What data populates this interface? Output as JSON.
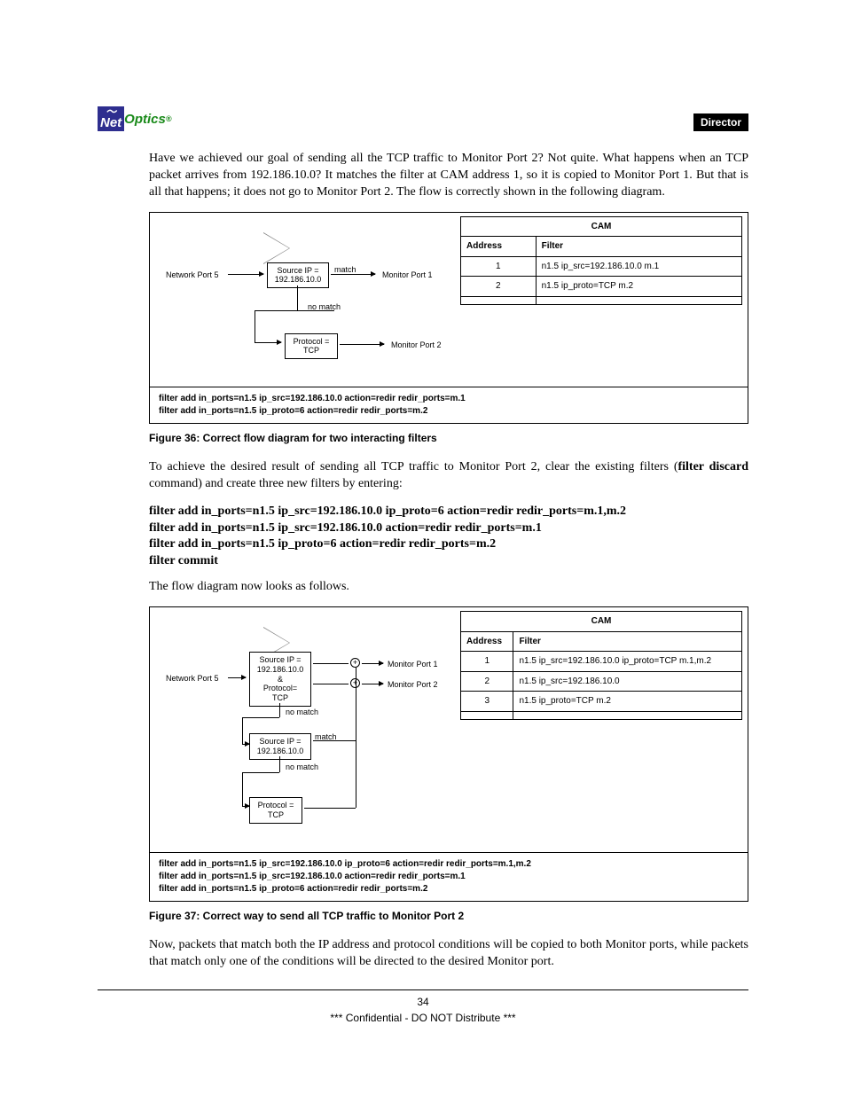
{
  "header": {
    "logo_net": "Net",
    "logo_optics": "Optics",
    "logo_reg": "®",
    "doc_tag": "Director"
  },
  "para1": "Have we achieved our goal of sending all the TCP traffic to Monitor Port 2? Not quite. What happens when an TCP packet arrives from 192.186.10.0? It matches the filter at CAM address 1, so it is copied to Monitor Port 1. But that is all that happens; it does not go to Monitor Port 2. The flow is correctly shown in the following diagram.",
  "fig36": {
    "network_port": "Network Port 5",
    "src_ip": "Source IP =\n192.186.10.0",
    "match": "match",
    "no_match": "no match",
    "proto": "Protocol =\nTCP",
    "mon1": "Monitor Port 1",
    "mon2": "Monitor Port 2",
    "cmds": [
      "filter add in_ports=n1.5 ip_src=192.186.10.0 action=redir redir_ports=m.1",
      "filter add in_ports=n1.5 ip_proto=6 action=redir redir_ports=m.2"
    ],
    "cam_title": "CAM",
    "h_addr": "Address",
    "h_filter": "Filter",
    "rows": [
      {
        "a": "1",
        "f": "n1.5 ip_src=192.186.10.0 m.1"
      },
      {
        "a": "2",
        "f": "n1.5 ip_proto=TCP m.2"
      },
      {
        "a": "",
        "f": ""
      }
    ],
    "caption": "Figure 36: Correct flow diagram for two interacting filters"
  },
  "para2a": "To achieve the desired result of sending all TCP traffic to Monitor Port 2, clear the existing filters (",
  "para2b": "filter discard",
  "para2c": " command) and create three new filters by entering:",
  "cmdblock": [
    "filter add in_ports=n1.5 ip_src=192.186.10.0 ip_proto=6  action=redir redir_ports=m.1,m.2",
    "filter add in_ports=n1.5 ip_src=192.186.10.0 action=redir redir_ports=m.1",
    "filter add in_ports=n1.5 ip_proto=6 action=redir redir_ports=m.2",
    "filter commit"
  ],
  "para3": "The flow diagram now looks as follows.",
  "fig37": {
    "network_port": "Network Port 5",
    "combo": "Source IP =\n192.186.10.0\n&\nProtocol=\nTCP",
    "src_ip": "Source IP =\n192.186.10.0",
    "proto": "Protocol =\nTCP",
    "match": "match",
    "no_match": "no match",
    "mon1": "Monitor Port 1",
    "mon2": "Monitor Port 2",
    "cmds": [
      "filter add in_ports=n1.5 ip_src=192.186.10.0 ip_proto=6  action=redir redir_ports=m.1,m.2",
      "filter add in_ports=n1.5 ip_src=192.186.10.0 action=redir redir_ports=m.1",
      "filter add in_ports=n1.5 ip_proto=6 action=redir redir_ports=m.2"
    ],
    "cam_title": "CAM",
    "h_addr": "Address",
    "h_filter": "Filter",
    "rows": [
      {
        "a": "1",
        "f": "n1.5 ip_src=192.186.10.0 ip_proto=TCP m.1,m.2"
      },
      {
        "a": "2",
        "f": "n1.5 ip_src=192.186.10.0"
      },
      {
        "a": "3",
        "f": "n1.5 ip_proto=TCP m.2"
      },
      {
        "a": "",
        "f": ""
      }
    ],
    "caption": "Figure 37: Correct way to send all TCP traffic to Monitor Port 2"
  },
  "para4": "Now, packets that match both the IP address and protocol conditions will be copied to both Monitor ports, while packets that match only one of the conditions will be directed to the desired Monitor port.",
  "footer": {
    "page": "34",
    "conf": "*** Confidential - DO NOT Distribute ***"
  }
}
